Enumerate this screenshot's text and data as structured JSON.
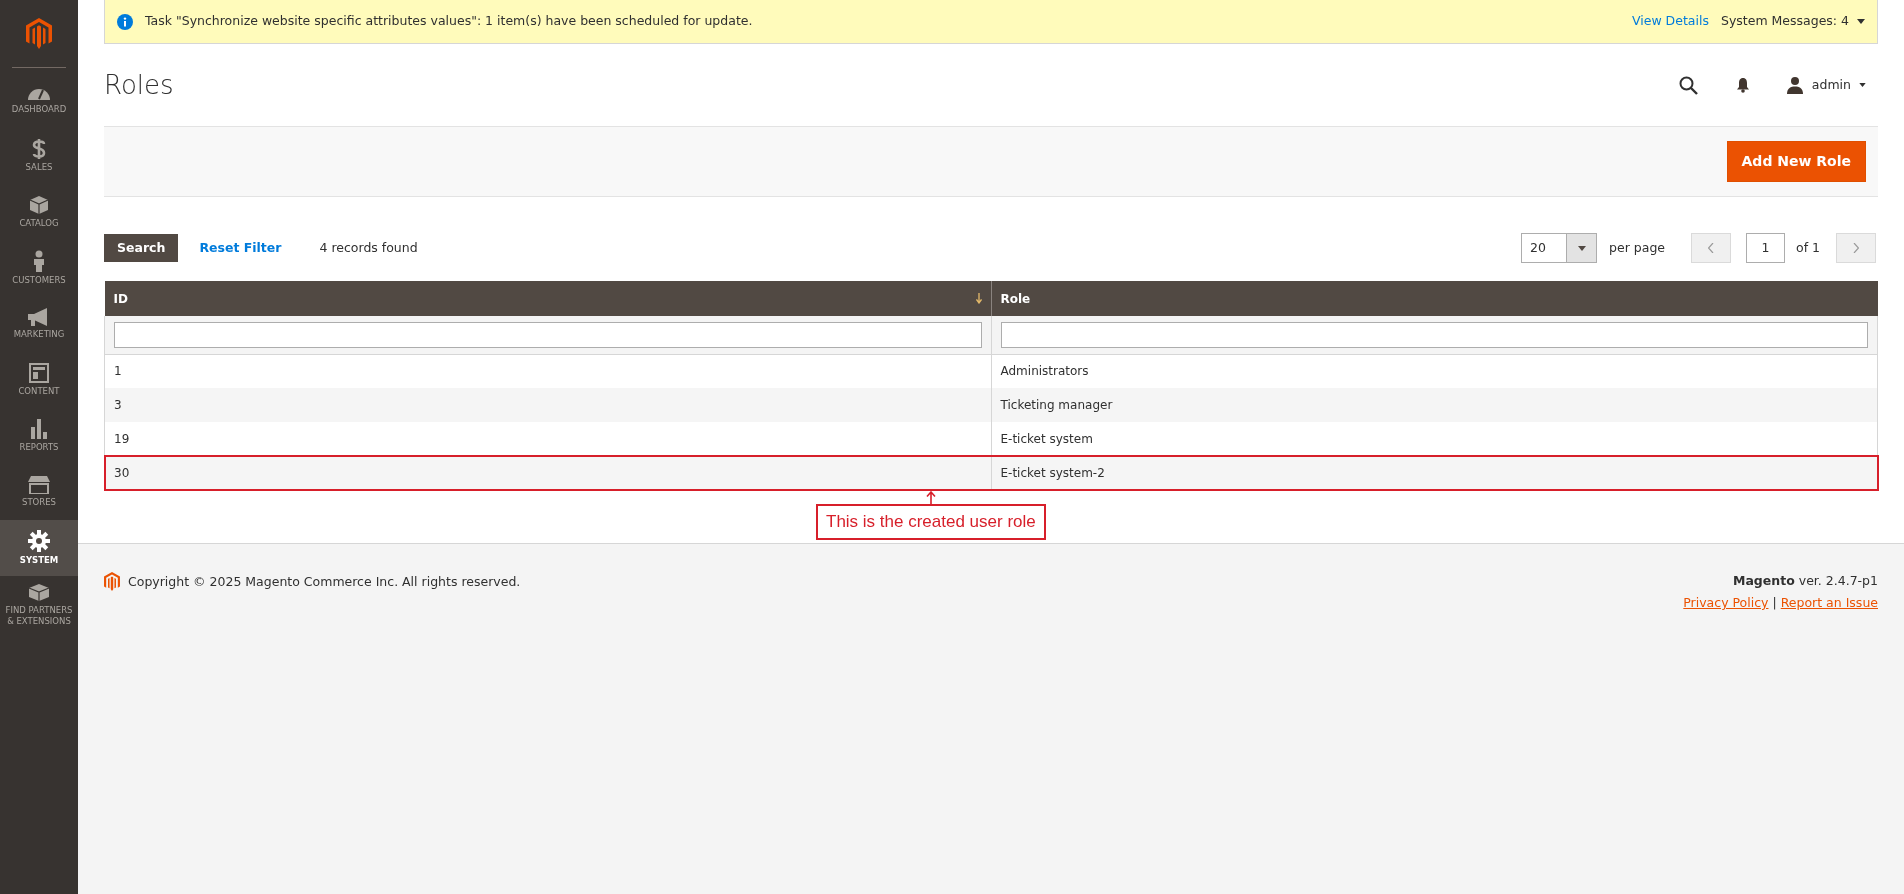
{
  "sidebar": {
    "items": [
      {
        "label": "DASHBOARD",
        "selected": false
      },
      {
        "label": "SALES",
        "selected": false
      },
      {
        "label": "CATALOG",
        "selected": false
      },
      {
        "label": "CUSTOMERS",
        "selected": false
      },
      {
        "label": "MARKETING",
        "selected": false
      },
      {
        "label": "CONTENT",
        "selected": false
      },
      {
        "label": "REPORTS",
        "selected": false
      },
      {
        "label": "STORES",
        "selected": false
      },
      {
        "label": "SYSTEM",
        "selected": true
      },
      {
        "label": "FIND PARTNERS & EXTENSIONS",
        "selected": false
      }
    ]
  },
  "notice": {
    "message": "Task \"Synchronize website specific attributes values\": 1 item(s) have been scheduled for update.",
    "link": "View Details",
    "system_messages": "System Messages: 4"
  },
  "header": {
    "title": "Roles",
    "user": "admin"
  },
  "actions": {
    "primary_button": "Add New Role"
  },
  "toolbar": {
    "search_button": "Search",
    "reset_link": "Reset Filter",
    "records": "4 records found",
    "per_page_value": "20",
    "per_page_label": "per page",
    "page": "1",
    "page_total": "of 1"
  },
  "grid": {
    "columns": [
      {
        "label": "ID",
        "sorted": true
      },
      {
        "label": "Role",
        "sorted": false
      }
    ],
    "rows": [
      {
        "id": "1",
        "role": "Administrators",
        "annotated": false
      },
      {
        "id": "3",
        "role": "Ticketing manager",
        "annotated": false
      },
      {
        "id": "19",
        "role": "E-ticket system",
        "annotated": false
      },
      {
        "id": "30",
        "role": "E-ticket system-2",
        "annotated": true
      }
    ]
  },
  "annotation": {
    "label": "This is the created user role"
  },
  "footer": {
    "copyright": "Copyright © 2025 Magento Commerce Inc. All rights reserved.",
    "brand": "Magento",
    "version": "ver. 2.4.7-p1",
    "links": [
      "Privacy Policy",
      "Report an Issue"
    ],
    "separator": "|"
  }
}
